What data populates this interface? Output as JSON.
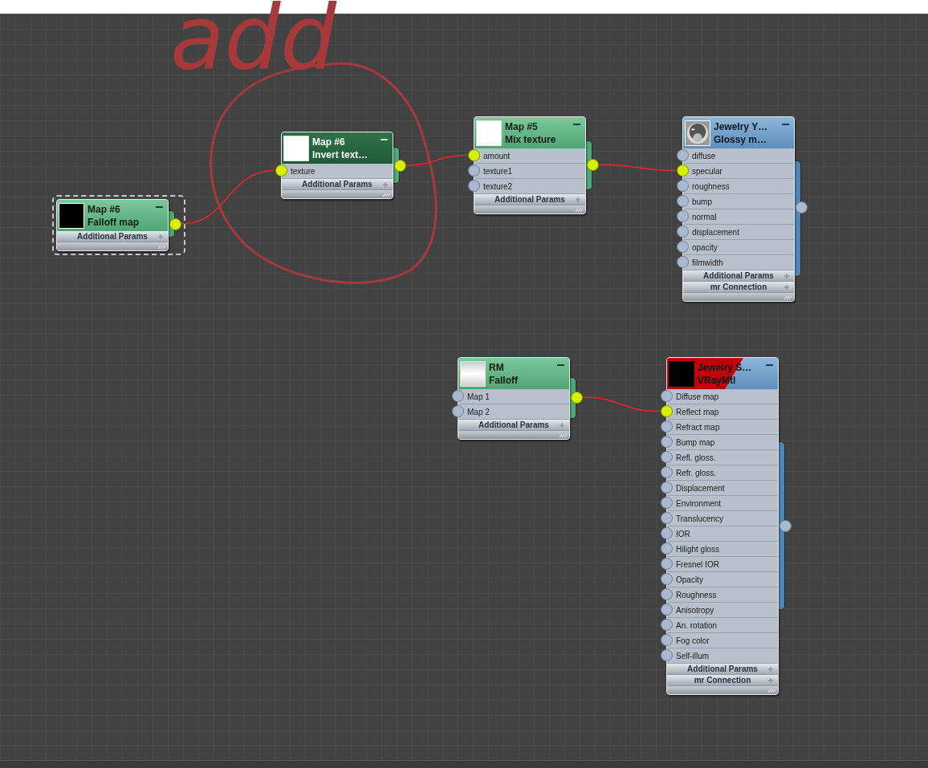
{
  "annotation": {
    "text": "add"
  },
  "nodes": [
    {
      "kind": "map",
      "selected": true,
      "active": false,
      "preview": {
        "kind": "black"
      },
      "title": "Map #6",
      "subtitle": "Falloff map",
      "panels": [
        "Additional Params"
      ],
      "output_connected": true
    },
    {
      "kind": "map",
      "selected": false,
      "active": true,
      "preview": {
        "kind": "white"
      },
      "title": "Map #6",
      "subtitle": "Invert text…",
      "sockets": [
        {
          "label": "texture",
          "connected": true
        }
      ],
      "panels": [
        "Additional Params"
      ],
      "output_connected": true
    },
    {
      "kind": "map",
      "selected": false,
      "active": false,
      "preview": {
        "kind": "white"
      },
      "title": "Map #5",
      "subtitle": "Mix texture",
      "sockets": [
        {
          "label": "amount",
          "connected": true
        },
        {
          "label": "texture1",
          "connected": false
        },
        {
          "label": "texture2",
          "connected": false
        }
      ],
      "panels": [
        "Additional Params"
      ],
      "output_connected": true
    },
    {
      "kind": "material",
      "selected": false,
      "active": false,
      "preview": {
        "kind": "sphere"
      },
      "title": "Jewelry Y…",
      "subtitle": "Glossy m…",
      "sockets": [
        {
          "label": "diffuse",
          "connected": false
        },
        {
          "label": "specular",
          "connected": true
        },
        {
          "label": "roughness",
          "connected": false
        },
        {
          "label": "bump",
          "connected": false
        },
        {
          "label": "normal",
          "connected": false
        },
        {
          "label": "displacement",
          "connected": false
        },
        {
          "label": "opacity",
          "connected": false
        },
        {
          "label": "filmwidth",
          "connected": false
        }
      ],
      "panels": [
        "Additional Params",
        "mr Connection"
      ],
      "output_connected": false
    },
    {
      "kind": "map",
      "selected": false,
      "active": false,
      "preview": {
        "kind": "gradient"
      },
      "title": "RM",
      "subtitle": "Falloff",
      "sockets": [
        {
          "label": "Map 1",
          "connected": false
        },
        {
          "label": "Map 2",
          "connected": false
        }
      ],
      "panels": [
        "Additional Params"
      ],
      "output_connected": true
    },
    {
      "kind": "material",
      "selected": false,
      "active": false,
      "preview": {
        "kind": "error"
      },
      "title": "Jewelry S…",
      "subtitle": "VRayMtl",
      "sockets": [
        {
          "label": "Diffuse map",
          "connected": false
        },
        {
          "label": "Reflect map",
          "connected": true
        },
        {
          "label": "Refract map",
          "connected": false
        },
        {
          "label": "Bump map",
          "connected": false
        },
        {
          "label": "Refl. gloss.",
          "connected": false
        },
        {
          "label": "Refr. gloss.",
          "connected": false
        },
        {
          "label": "Displacement",
          "connected": false
        },
        {
          "label": "Environment",
          "connected": false
        },
        {
          "label": "Translucency",
          "connected": false
        },
        {
          "label": "IOR",
          "connected": false
        },
        {
          "label": "Hilight gloss",
          "connected": false
        },
        {
          "label": "Fresnel IOR",
          "connected": false
        },
        {
          "label": "Opacity",
          "connected": false
        },
        {
          "label": "Roughness",
          "connected": false
        },
        {
          "label": "Anisotropy",
          "connected": false
        },
        {
          "label": "An. rotation",
          "connected": false
        },
        {
          "label": "Fog color",
          "connected": false
        },
        {
          "label": "Self-illum",
          "connected": false
        }
      ],
      "panels": [
        "Additional Params",
        "mr Connection"
      ],
      "output_connected": false
    }
  ]
}
